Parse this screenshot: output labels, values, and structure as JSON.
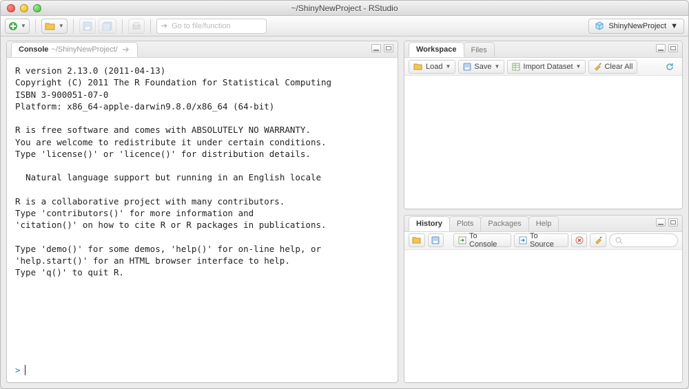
{
  "window": {
    "title": "~/ShinyNewProject - RStudio"
  },
  "main_toolbar": {
    "gotofile_placeholder": "Go to file/function",
    "project_button_label": "ShinyNewProject"
  },
  "console": {
    "tab_label": "Console",
    "path": "~/ShinyNewProject/",
    "lines": [
      "R version 2.13.0 (2011-04-13)",
      "Copyright (C) 2011 The R Foundation for Statistical Computing",
      "ISBN 3-900051-07-0",
      "Platform: x86_64-apple-darwin9.8.0/x86_64 (64-bit)",
      "",
      "R is free software and comes with ABSOLUTELY NO WARRANTY.",
      "You are welcome to redistribute it under certain conditions.",
      "Type 'license()' or 'licence()' for distribution details.",
      "",
      "  Natural language support but running in an English locale",
      "",
      "R is a collaborative project with many contributors.",
      "Type 'contributors()' for more information and",
      "'citation()' on how to cite R or R packages in publications.",
      "",
      "Type 'demo()' for some demos, 'help()' for on-line help, or",
      "'help.start()' for an HTML browser interface to help.",
      "Type 'q()' to quit R.",
      ""
    ],
    "prompt": ">"
  },
  "top_right": {
    "tabs": [
      "Workspace",
      "Files"
    ],
    "active_tab": 0,
    "toolbar": {
      "load": "Load",
      "save": "Save",
      "import": "Import Dataset",
      "clear": "Clear All"
    }
  },
  "bottom_right": {
    "tabs": [
      "History",
      "Plots",
      "Packages",
      "Help"
    ],
    "active_tab": 0,
    "toolbar": {
      "to_console": "To Console",
      "to_source": "To Source"
    }
  }
}
